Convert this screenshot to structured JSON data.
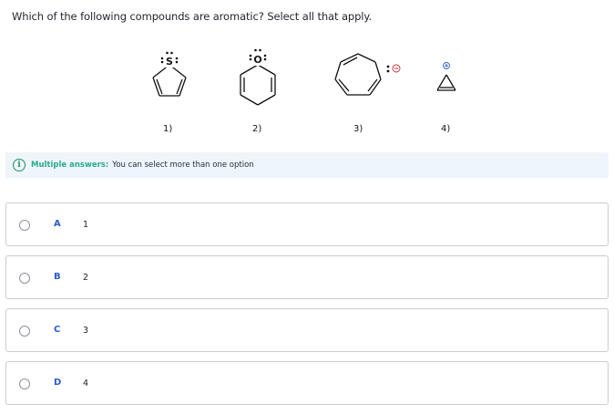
{
  "question": {
    "text": "Which of the following compounds are aromatic? Select all that apply."
  },
  "structures": [
    {
      "label": "1)",
      "lone_pair_atom": "S"
    },
    {
      "label": "2)",
      "lone_pair_atom": "O"
    },
    {
      "label": "3)",
      "charge": "⊖"
    },
    {
      "label": "4)",
      "charge": "⊕"
    }
  ],
  "info": {
    "title": "Multiple answers:",
    "text": "You can select more than one option"
  },
  "options": [
    {
      "letter": "A",
      "value": "1"
    },
    {
      "letter": "B",
      "value": "2"
    },
    {
      "letter": "C",
      "value": "3"
    },
    {
      "letter": "D",
      "value": "4"
    }
  ],
  "colors": {
    "accent": "#2c5cc5",
    "info_green": "#2aa88a",
    "banner_bg": "#eef5fb",
    "border": "#c9ccd1"
  }
}
